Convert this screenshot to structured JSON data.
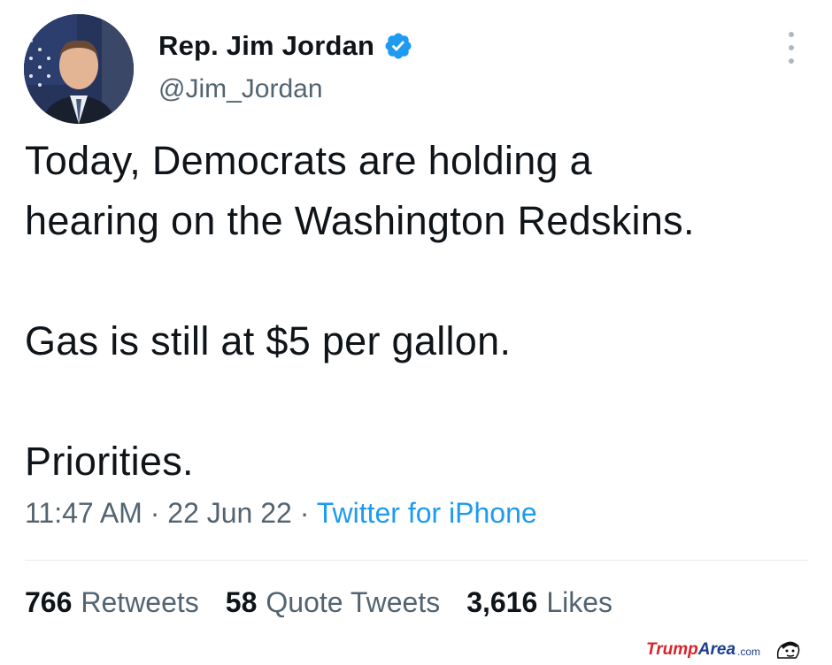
{
  "author": {
    "display_name": "Rep. Jim Jordan",
    "handle": "@Jim_Jordan",
    "verified_icon": "verified-badge-icon",
    "verified_color": "#1d9bf0"
  },
  "tweet": {
    "lines_1": [
      "Today, Democrats are holding a",
      "hearing on the Washington Redskins."
    ],
    "line_1": "Today, Democrats are holding a",
    "line_2": "hearing on the Washington Redskins.",
    "line_3": "Gas is still at $5 per gallon.",
    "line_4": "Priorities."
  },
  "meta": {
    "time": "11:47 AM",
    "separator": " · ",
    "date": "22 Jun 22",
    "source": "Twitter for iPhone"
  },
  "stats": {
    "retweets_count": "766",
    "retweets_label": "Retweets",
    "quotes_count": "58",
    "quotes_label": "Quote Tweets",
    "likes_count": "3,616",
    "likes_label": "Likes"
  },
  "watermark": {
    "trump": "Trump",
    "area": "Area",
    "com": ".com"
  },
  "colors": {
    "text": "#0f1419",
    "secondary": "#536471",
    "link": "#1d9bf0"
  }
}
